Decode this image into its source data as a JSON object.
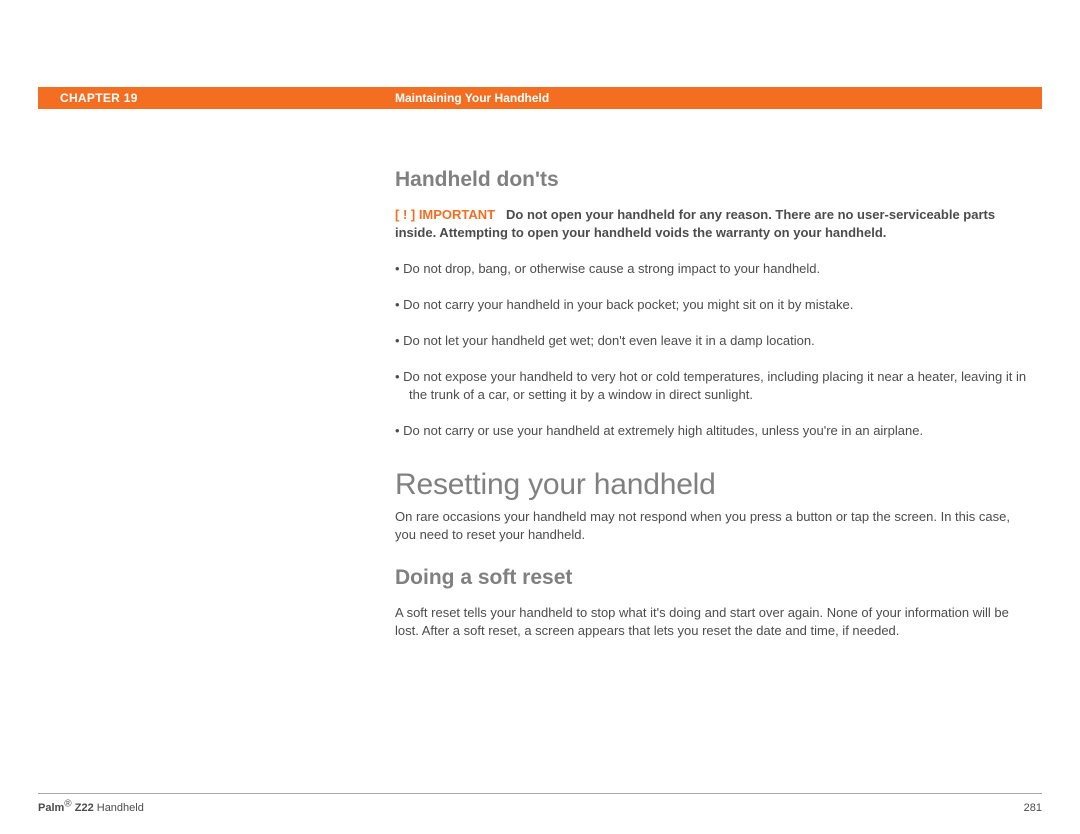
{
  "header": {
    "chapter": "CHAPTER 19",
    "title": "Maintaining Your Handheld"
  },
  "sections": {
    "donts": {
      "heading": "Handheld don'ts",
      "important_tag": "[ ! ] IMPORTANT",
      "important_body": "Do not open your handheld for any reason. There are no user-serviceable parts inside. Attempting to open your handheld voids the warranty on your handheld.",
      "bullets": [
        "Do not drop, bang, or otherwise cause a strong impact to your handheld.",
        "Do not carry your handheld in your back pocket; you might sit on it by mistake.",
        "Do not let your handheld get wet; don't even leave it in a damp location.",
        "Do not expose your handheld to very hot or cold temperatures, including placing it near a heater, leaving it in the trunk of a car, or setting it by a window in direct sunlight.",
        "Do not carry or use your handheld at extremely high altitudes, unless you're in an airplane."
      ]
    },
    "resetting": {
      "heading": "Resetting your handheld",
      "intro": "On rare occasions your handheld may not respond when you press a button or tap the screen. In this case, you need to reset your handheld."
    },
    "soft_reset": {
      "heading": "Doing a soft reset",
      "body": "A soft reset tells your handheld to stop what it's doing and start over again. None of your information will be lost. After a soft reset, a screen appears that lets you reset the date and time, if needed."
    }
  },
  "footer": {
    "product_bold": "Palm",
    "product_model": " Z22",
    "product_rest": " Handheld",
    "reg_mark": "®",
    "page_number": "281"
  }
}
